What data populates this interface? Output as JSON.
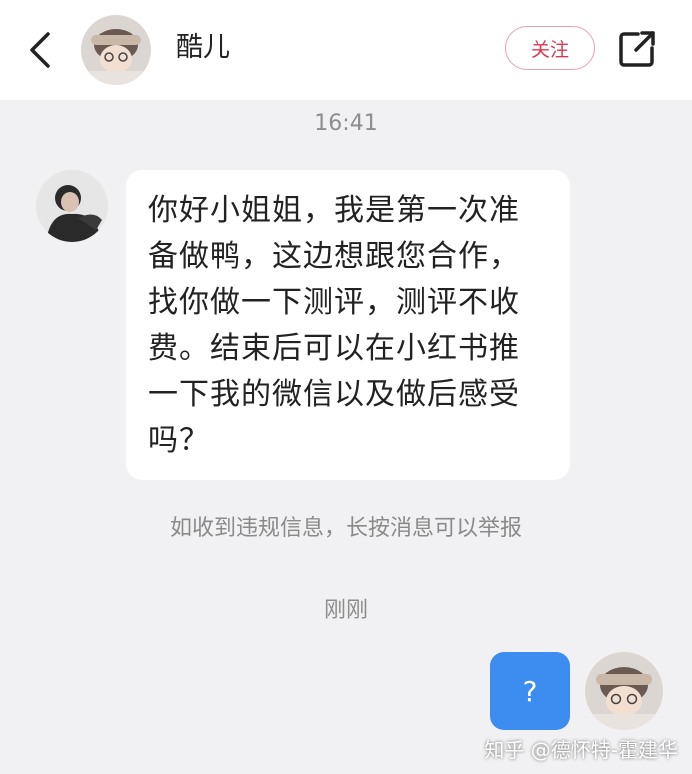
{
  "header": {
    "back_icon": "chevron-left-icon",
    "title": "酷儿",
    "follow_label": "关注",
    "share_icon": "share-icon",
    "accent_color": "#d8394f"
  },
  "conversation": {
    "time_top": "16:41",
    "incoming_message": {
      "lines": [
        "你好小姐姐，我是第一次准",
        "备做鸭，这边想跟您合作，",
        "找你做一下测评，测评不收",
        "费。结束后可以在小红书推",
        "一下我的微信以及做后感受",
        "吗？"
      ]
    },
    "report_notice": "如收到违规信息，长按消息可以举报",
    "time_recent": "刚刚",
    "outgoing_message": {
      "text": "?",
      "bubble_color": "#3d8cf0"
    }
  },
  "watermark": "知乎 @德怀特-霍建华"
}
